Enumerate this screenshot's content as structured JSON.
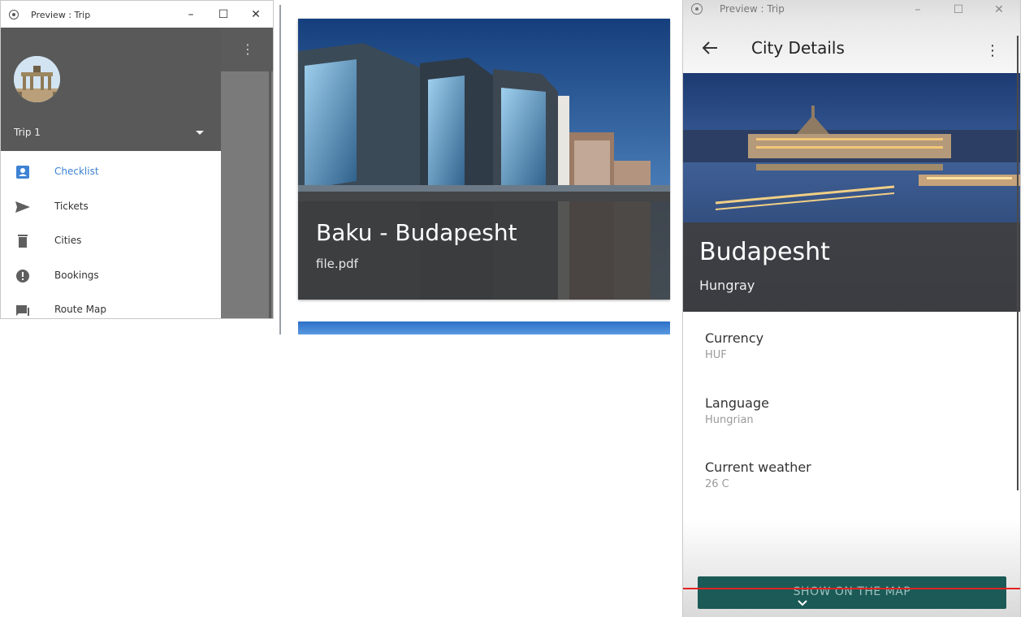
{
  "left_window": {
    "title": "Preview : Trip",
    "controls": {
      "minimize": "–",
      "maximize": "☐",
      "close": "✕"
    },
    "drawer": {
      "trip_selector": "Trip 1",
      "items": [
        {
          "label": "Checklist",
          "icon": "checklist-icon",
          "active": true
        },
        {
          "label": "Tickets",
          "icon": "send-icon",
          "active": false
        },
        {
          "label": "Cities",
          "icon": "trash-icon",
          "active": false
        },
        {
          "label": "Bookings",
          "icon": "alert-icon",
          "active": false
        },
        {
          "label": "Route Map",
          "icon": "chat-icon",
          "active": false
        }
      ]
    },
    "more_icon": "⋮"
  },
  "middle_panel": {
    "card": {
      "title": "Baku - Budapesht",
      "subtitle": "file.pdf"
    }
  },
  "right_window": {
    "title": "Preview : Trip",
    "controls": {
      "minimize": "–",
      "maximize": "☐",
      "close": "✕"
    },
    "appbar": {
      "title": "City Details",
      "more_icon": "⋮"
    },
    "hero": {
      "city": "Budapesht",
      "country": "Hungray"
    },
    "details": [
      {
        "label": "Currency",
        "value": "HUF"
      },
      {
        "label": "Language",
        "value": "Hungrian"
      },
      {
        "label": "Current weather",
        "value": "26 C"
      }
    ],
    "map_button": "SHOW ON THE MAP"
  },
  "colors": {
    "accent_blue": "#3d82d4",
    "drawer_header": "#595959",
    "map_button": "#1b5a56",
    "red_line": "#e32222"
  }
}
